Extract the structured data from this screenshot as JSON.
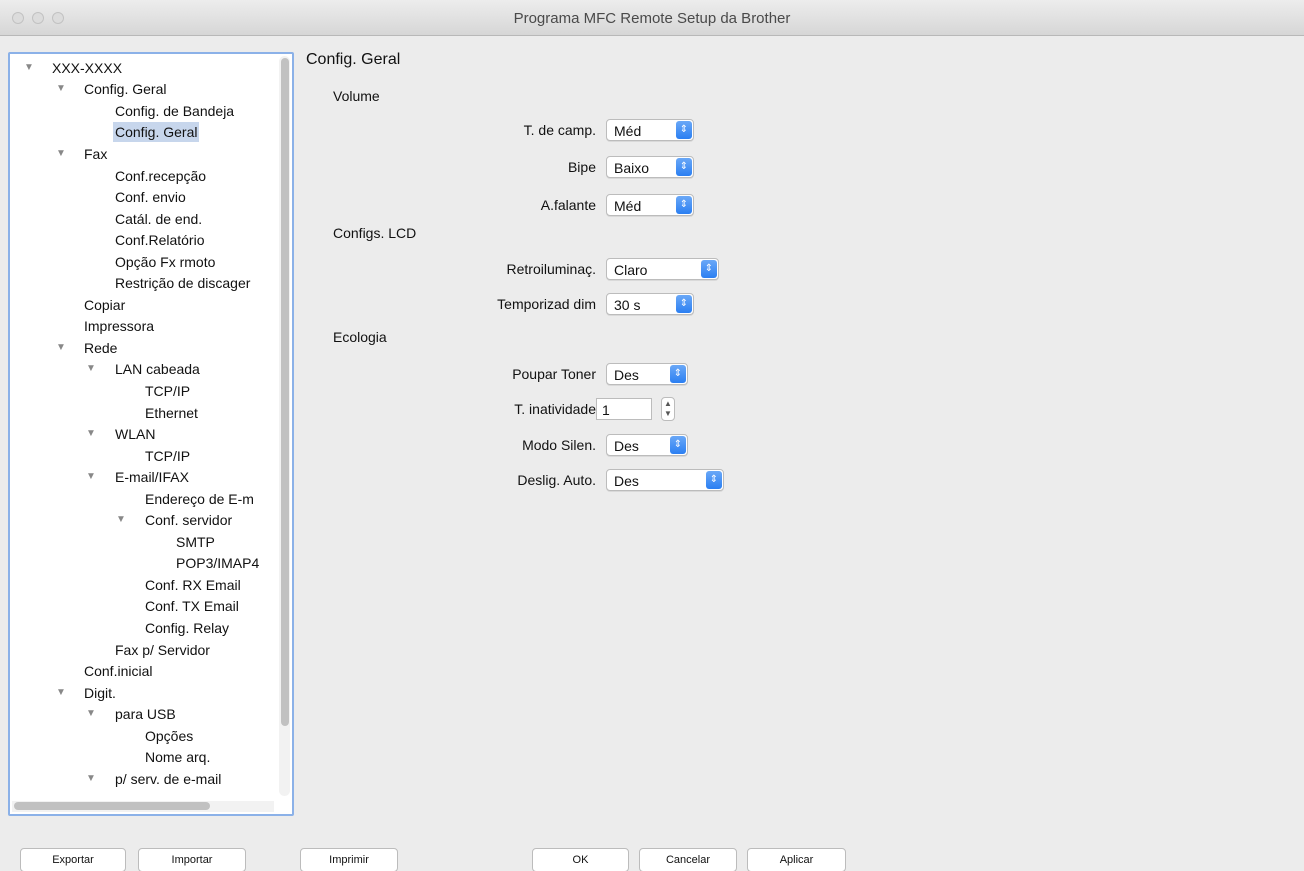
{
  "window": {
    "title": "Programa MFC Remote Setup da Brother"
  },
  "tree": {
    "items": [
      {
        "label": "XXX-XXXX",
        "expanded": true
      },
      {
        "label": "Config. Geral",
        "expanded": true
      },
      {
        "label": "Config. de Bandeja"
      },
      {
        "label": "Config. Geral",
        "selected": true
      },
      {
        "label": "Fax",
        "expanded": true
      },
      {
        "label": "Conf.recepção"
      },
      {
        "label": "Conf. envio"
      },
      {
        "label": "Catál. de end."
      },
      {
        "label": "Conf.Relatório"
      },
      {
        "label": "Opção Fx rmoto"
      },
      {
        "label": "Restrição de discager"
      },
      {
        "label": "Copiar"
      },
      {
        "label": "Impressora"
      },
      {
        "label": "Rede",
        "expanded": true
      },
      {
        "label": "LAN cabeada",
        "expanded": true
      },
      {
        "label": "TCP/IP"
      },
      {
        "label": "Ethernet"
      },
      {
        "label": "WLAN",
        "expanded": true
      },
      {
        "label": "TCP/IP"
      },
      {
        "label": "E-mail/IFAX",
        "expanded": true
      },
      {
        "label": "Endereço de E-m"
      },
      {
        "label": "Conf. servidor",
        "expanded": true
      },
      {
        "label": "SMTP"
      },
      {
        "label": "POP3/IMAP4"
      },
      {
        "label": "Conf. RX Email"
      },
      {
        "label": "Conf. TX Email"
      },
      {
        "label": "Config. Relay"
      },
      {
        "label": "Fax p/ Servidor"
      },
      {
        "label": "Conf.inicial"
      },
      {
        "label": "Digit.",
        "expanded": true
      },
      {
        "label": "para USB",
        "expanded": true
      },
      {
        "label": "Opções"
      },
      {
        "label": "Nome arq."
      },
      {
        "label": "p/ serv. de e-mail",
        "expanded": true
      }
    ]
  },
  "panel": {
    "title": "Config. Geral",
    "volume": {
      "heading": "Volume",
      "ring_label": "T. de camp.",
      "ring_value": "Méd",
      "beep_label": "Bipe",
      "beep_value": "Baixo",
      "speaker_label": "A.falante",
      "speaker_value": "Méd"
    },
    "lcd": {
      "heading": "Configs. LCD",
      "backlight_label": "Retroiluminaç.",
      "backlight_value": "Claro",
      "dim_timer_label": "Temporizad dim",
      "dim_timer_value": "30 s"
    },
    "ecology": {
      "heading": "Ecologia",
      "toner_save_label": "Poupar Toner",
      "toner_save_value": "Des",
      "sleep_time_label": "T. inatividade",
      "sleep_time_value": "1",
      "quiet_mode_label": "Modo Silen.",
      "quiet_mode_value": "Des",
      "auto_off_label": "Deslig. Auto.",
      "auto_off_value": "Des"
    }
  },
  "buttons": {
    "export": "Exportar",
    "import": "Importar",
    "print": "Imprimir",
    "ok": "OK",
    "cancel": "Cancelar",
    "apply": "Aplicar"
  },
  "colors": {
    "selection": "#c7d6ec",
    "accent": "#2b7ff2",
    "focus_ring": "#8bb1e8"
  }
}
